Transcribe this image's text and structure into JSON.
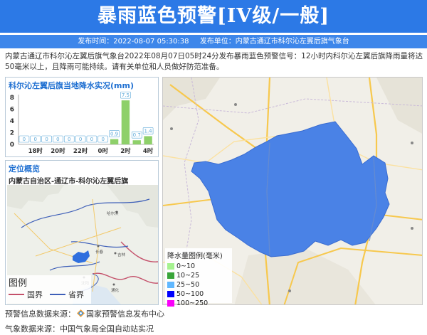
{
  "header": {
    "title": "暴雨蓝色预警[IV级/一般]"
  },
  "subheader": {
    "publish_time": "发布时间：2022-08-07 05:30:38",
    "publisher": "发布单位：内蒙古通辽市科尔沁左翼后旗气象台"
  },
  "description": "内蒙古通辽市科尔沁左翼后旗气象台2022年08月07日05时24分发布暴雨蓝色预警信号：12小时内科尔沁左翼后旗降雨量将达50毫米以上，且降雨可能持续。请有关单位和人员做好防范准备。",
  "rain_panel": {
    "title": "科尔沁左翼后旗当地降水实况(mm)"
  },
  "chart_data": {
    "type": "bar",
    "title": "科尔沁左翼后旗当地降水实况(mm)",
    "categories": [
      "",
      "18时",
      "",
      "20时",
      "",
      "22时",
      "",
      "0时",
      "",
      "2时",
      "",
      "4时"
    ],
    "values": [
      0,
      0,
      0,
      0,
      0,
      0,
      0,
      0,
      0.9,
      7.5,
      0.7,
      1.4
    ],
    "value_labels": [
      "0",
      "0",
      "0",
      "0",
      "0",
      "0",
      "0",
      "0",
      "0.9",
      "7.5",
      "0.7",
      "1.4"
    ],
    "yticks": [
      "0",
      "2",
      "4",
      "6",
      "8"
    ],
    "ylim": [
      0,
      8
    ],
    "bar_color": "#8ed06a",
    "label_color": "#5ba8d8"
  },
  "location": {
    "title": "定位概览",
    "subtitle": "内蒙古自治区-通辽市-科尔沁左翼后旗",
    "cities": [
      "哈尔滨",
      "长春",
      "吉林",
      "沈阳",
      "通化"
    ]
  },
  "legend": {
    "title": "图例",
    "items": [
      {
        "label": "国界",
        "color": "#c4506a"
      },
      {
        "label": "省界",
        "color": "#3e5fb8"
      }
    ]
  },
  "rain_legend": {
    "title": "降水量图例(毫米)",
    "items": [
      {
        "label": "0~10",
        "color": "#a6f28f"
      },
      {
        "label": "10~25",
        "color": "#3aa53a"
      },
      {
        "label": "25~50",
        "color": "#61b8ff"
      },
      {
        "label": "50~100",
        "color": "#0000fe"
      },
      {
        "label": "100~250",
        "color": "#fa00fa"
      }
    ]
  },
  "region_color": "#4a82e6",
  "footer": {
    "warning_source_label": "预警信息数据来源：",
    "warning_source": "国家预警信息发布中心",
    "weather_source_label": "气象数据来源：",
    "weather_source": "中国气象局全国自动站实况"
  }
}
